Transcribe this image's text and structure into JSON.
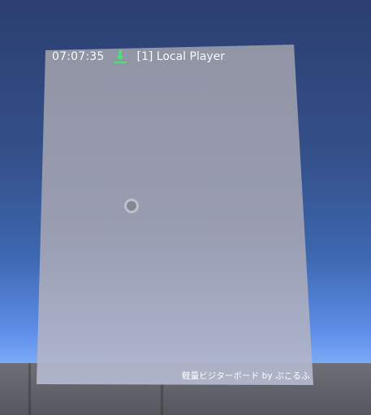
{
  "header": {
    "time": "07:07:35",
    "status_icon": "download-icon",
    "player_label": "[1] Local Player"
  },
  "footer": {
    "text": "軽量ビジターボード by ぷこるふ"
  },
  "colors": {
    "accent_green": "#4fe07c",
    "text_white": "#ffffff"
  }
}
